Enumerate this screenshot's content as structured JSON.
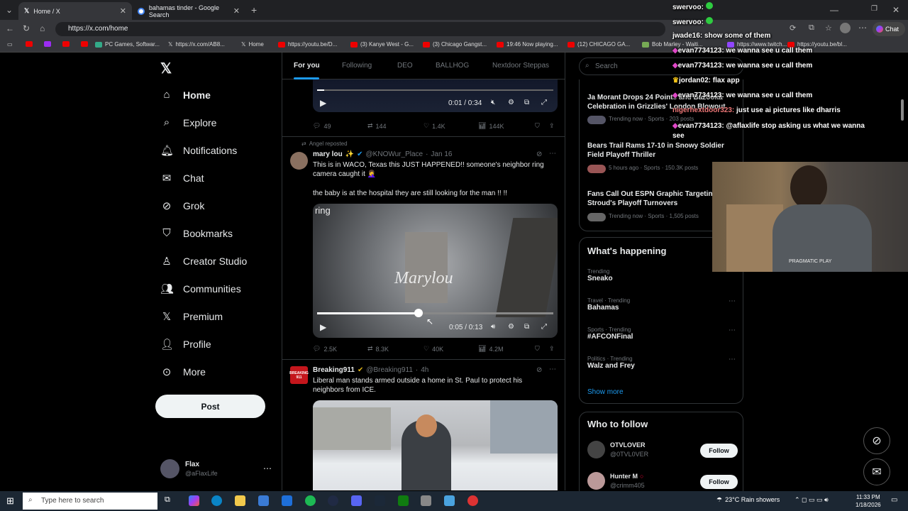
{
  "browser": {
    "tabs": [
      {
        "title": "Home / X"
      },
      {
        "title": "bahamas tinder - Google Search"
      }
    ],
    "url": "https://x.com/home",
    "chat_label": "Chat",
    "bookmarks": [
      "PC Games, Softwar...",
      "https://x.com/AB8...",
      "Home",
      "https://youtu.be/D...",
      "(3) Kanye West - G...",
      "(3) Chicago Gangst...",
      "19:46 Now playing...",
      "(12) CHICAGO GA...",
      "Bob Marley - Waiti...",
      "https://www.twitch...",
      "https://youtu.be/bl..."
    ]
  },
  "nav": {
    "items": [
      {
        "label": "Home",
        "icon": "home-icon"
      },
      {
        "label": "Explore",
        "icon": "search-icon"
      },
      {
        "label": "Notifications",
        "icon": "bell-icon"
      },
      {
        "label": "Chat",
        "icon": "mail-icon"
      },
      {
        "label": "Grok",
        "icon": "grok-icon"
      },
      {
        "label": "Bookmarks",
        "icon": "bookmark-icon"
      },
      {
        "label": "Creator Studio",
        "icon": "creator-icon"
      },
      {
        "label": "Communities",
        "icon": "people-icon"
      },
      {
        "label": "Premium",
        "icon": "x-icon"
      },
      {
        "label": "Profile",
        "icon": "person-icon"
      },
      {
        "label": "More",
        "icon": "more-icon"
      }
    ],
    "post_label": "Post",
    "account": {
      "name": "Flax",
      "handle": "@aFlaxLife"
    }
  },
  "feed": {
    "tabs": [
      "For you",
      "Following",
      "DEO",
      "BALLHOG",
      "Nextdoor Steppas"
    ],
    "tweet1": {
      "time": "0:01 / 0:34",
      "replies": "49",
      "retweets": "144",
      "likes": "1.4K",
      "views": "144K"
    },
    "tweet2": {
      "reposted": "Angel reposted",
      "name": "mary lou",
      "handle": "@KNOWur_Place",
      "date": "Jan 16",
      "text1": "This is in WACO, Texas this JUST HAPPENED!! someone's neighbor ring camera caught it 🤦‍♀️",
      "text2": "the baby is at the hospital they are still looking for the man !! !!",
      "overlay_ring": "ring",
      "watermark": "Marylou",
      "time": "0:05 / 0:13",
      "progress": 0.43,
      "replies": "2.5K",
      "retweets": "8.3K",
      "likes": "40K",
      "views": "4.2M"
    },
    "tweet3": {
      "name": "Breaking911",
      "handle": "@Breaking911",
      "date": "4h",
      "text": "Liberal man stands armed outside a home in St. Paul to protect his neighbors from ICE.",
      "avatar_text": "BREAKING 911"
    }
  },
  "right": {
    "search_placeholder": "Search",
    "news": [
      {
        "title": "Ja Morant Drops 24 Points and Bazooka Celebration in Grizzlies' London Blowout",
        "meta": "Trending now · Sports · 203 posts"
      },
      {
        "title": "Bears Trail Rams 17-10 in Snowy Soldier Field Playoff Thriller",
        "meta": "5 hours ago · Sports · 150.3K posts"
      },
      {
        "title": "Fans Call Out ESPN Graphic Targeting Stroud's Playoff Turnovers",
        "meta": "Trending now · Sports · 1,505 posts"
      }
    ],
    "whats_happening": "What's happening",
    "trends": [
      {
        "meta": "Trending",
        "name": "Sneako"
      },
      {
        "meta": "Travel · Trending",
        "name": "Bahamas"
      },
      {
        "meta": "Sports · Trending",
        "name": "#AFCONFinal"
      },
      {
        "meta": "Politics · Trending",
        "name": "Walz and Frey"
      }
    ],
    "show_more": "Show more",
    "who_to_follow": "Who to follow",
    "follow": [
      {
        "name": "OTVLOVER",
        "handle": "@0TVL0VER"
      },
      {
        "name": "Hunter M",
        "handle": "@crimm405"
      }
    ],
    "follow_label": "Follow"
  },
  "stream_chat": [
    {
      "user": "swervoo:",
      "msg": ""
    },
    {
      "user": "swervoo:",
      "msg": ""
    },
    {
      "user": "jwade16:",
      "msg": "show some of them"
    },
    {
      "user": "evan7734123:",
      "msg": "we wanna see u call them"
    },
    {
      "user": "evan7734123:",
      "msg": "we wanna see u call them"
    },
    {
      "user": "jordan02:",
      "msg": "flax app"
    },
    {
      "user": "evan7734123:",
      "msg": "we wanna see u call them"
    },
    {
      "user": "nigerhextdoor323:",
      "msg": "just use ai pictures like dharris"
    },
    {
      "user": "evan7734123:",
      "msg": "@aflaxlife stop asking us what we wanna"
    },
    {
      "user": "",
      "msg": "see"
    }
  ],
  "webcam_shirt": "PRAGMATIC PLAY",
  "taskbar": {
    "search_placeholder": "Type here to search",
    "weather": "23°C  Rain showers",
    "time": "11:33 PM",
    "date": "1/18/2026"
  }
}
